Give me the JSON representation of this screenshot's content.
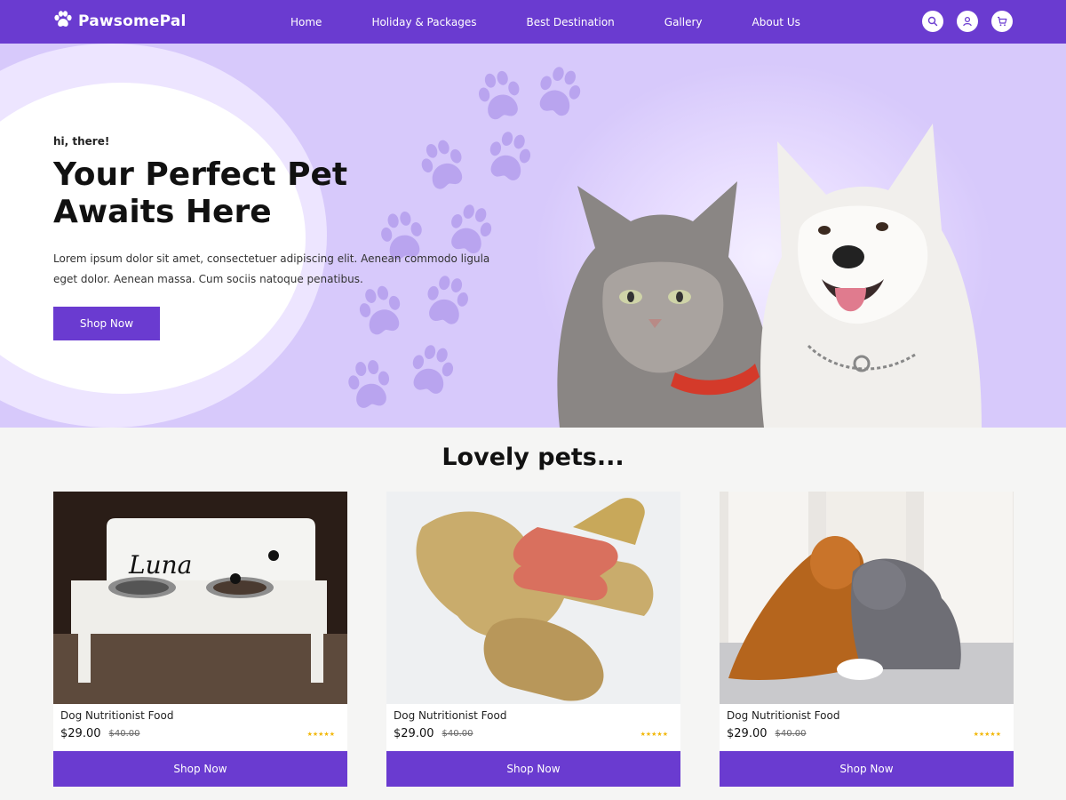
{
  "header": {
    "logo_text": "PawsomePal",
    "nav": [
      "Home",
      "Holiday & Packages",
      "Best Destination",
      "Gallery",
      "About Us"
    ],
    "icons": [
      "search-icon",
      "user-icon",
      "cart-icon"
    ]
  },
  "hero": {
    "greeting": "hi, there!",
    "title": "Your Perfect Pet Awaits Here",
    "description": "Lorem ipsum dolor sit amet, consectetuer adipiscing elit. Aenean commodo ligula eget dolor. Aenean massa. Cum sociis natoque penatibus.",
    "button": "Shop Now"
  },
  "section": {
    "title": "Lovely pets...",
    "cards": [
      {
        "name": "Dog Nutritionist Food",
        "price": "$29.00",
        "old_price": "$40.00",
        "stars": "★★★★★",
        "button": "Shop Now",
        "image_text": "Luna"
      },
      {
        "name": "Dog Nutritionist Food",
        "price": "$29.00",
        "old_price": "$40.00",
        "stars": "★★★★★",
        "button": "Shop Now"
      },
      {
        "name": "Dog Nutritionist Food",
        "price": "$29.00",
        "old_price": "$40.00",
        "stars": "★★★★★",
        "button": "Shop Now"
      }
    ]
  },
  "colors": {
    "primary": "#6a3bd0",
    "hero_bg": "#d7c9fb",
    "star": "#f2b705"
  }
}
